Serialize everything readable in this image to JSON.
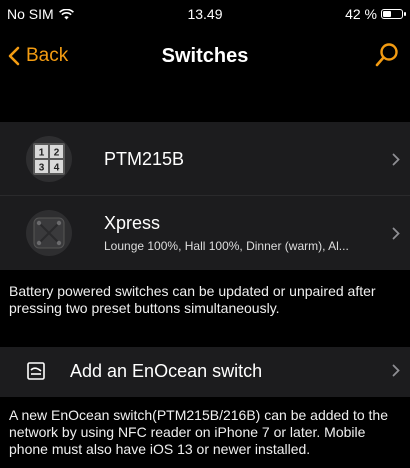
{
  "status_bar": {
    "carrier": "No SIM",
    "time": "13.49",
    "battery_percent": "42 %",
    "battery_level": 0.42
  },
  "nav": {
    "back_label": "Back",
    "title": "Switches"
  },
  "switches": [
    {
      "name": "PTM215B",
      "subtitle": "",
      "icon": "ptm215b-keypad-icon",
      "grid": [
        "1",
        "2",
        "3",
        "4"
      ]
    },
    {
      "name": "Xpress",
      "subtitle": "Lounge 100%, Hall 100%, Dinner (warm), Al...",
      "icon": "xpress-switch-icon"
    }
  ],
  "info_text_1": "Battery powered switches can be updated or unpaired after pressing two preset buttons simultaneously.",
  "add_switch": {
    "label": "Add an EnOcean switch",
    "icon": "add-switch-icon"
  },
  "info_text_2": "A new EnOcean switch(PTM215B/216B) can be added to the network by using NFC reader on iPhone 7 or later. Mobile phone must also have iOS 13 or newer installed.",
  "colors": {
    "accent": "#f39c12",
    "row_background": "#1c1c1e",
    "background": "#000000"
  }
}
